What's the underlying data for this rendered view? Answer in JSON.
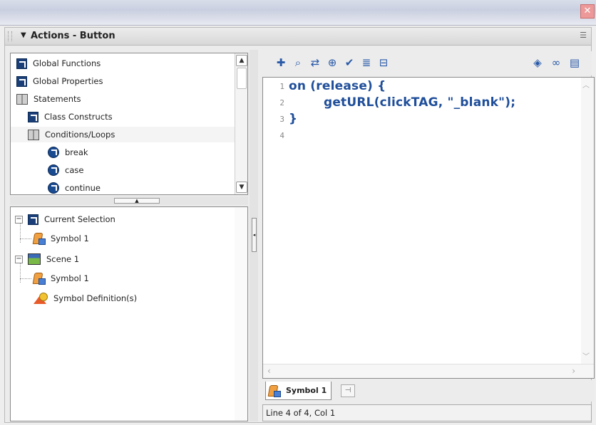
{
  "panel": {
    "title": "Actions - Button",
    "collapse_glyph": "▼",
    "options_glyph": "☰"
  },
  "window": {
    "close_glyph": "✕"
  },
  "toolbox": {
    "items": [
      {
        "label": "Global Functions",
        "icon": "book-closed-icon"
      },
      {
        "label": "Global Properties",
        "icon": "book-closed-icon"
      },
      {
        "label": "Statements",
        "icon": "book-open-icon"
      },
      {
        "label": "Class Constructs",
        "icon": "book-closed-icon"
      },
      {
        "label": "Conditions/Loops",
        "icon": "book-open-icon"
      },
      {
        "label": "break",
        "icon": "action-circle-icon"
      },
      {
        "label": "case",
        "icon": "action-circle-icon"
      },
      {
        "label": "continue",
        "icon": "action-circle-icon"
      }
    ]
  },
  "navigator": {
    "items": [
      {
        "label": "Current Selection",
        "icon": "book-closed-icon"
      },
      {
        "label": "Symbol 1",
        "icon": "symbol-icon"
      },
      {
        "label": "Scene 1",
        "icon": "scene-icon"
      },
      {
        "label": "Symbol 1",
        "icon": "symbol-icon"
      },
      {
        "label": "Symbol Definition(s)",
        "icon": "symbol-definition-icon"
      }
    ]
  },
  "toolbar": {
    "icons": [
      "add-action-icon",
      "find-icon",
      "replace-icon",
      "target-icon",
      "check-syntax-icon",
      "auto-format-icon",
      "code-hint-icon"
    ],
    "right_icons": [
      "debug-icon",
      "script-assist-icon",
      "menu-icon"
    ]
  },
  "editor": {
    "line_numbers": [
      "1",
      "2",
      "3",
      "4"
    ],
    "lines": [
      "on (release) {",
      "        getURL(clickTAG, \"_blank\");",
      "}",
      ""
    ]
  },
  "tabs": {
    "active_label": "Symbol 1",
    "pin_icon": "pin-script-icon"
  },
  "status": {
    "text": "Line 4 of 4, Col 1"
  }
}
